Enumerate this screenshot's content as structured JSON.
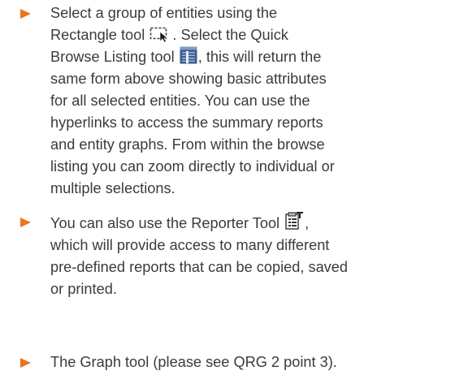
{
  "bullet_color": "#e8761e",
  "text_color": "#3b3b3b",
  "bullets": [
    {
      "icon_names": [
        "rectangle-select-tool-icon",
        "quick-browse-listing-tool-icon"
      ],
      "lines": {
        "l1": "Select a group of entities using the",
        "l2a": "Rectangle tool",
        "l2b": ". Select the Quick",
        "l3a": "Browse Listing tool",
        "l3b": ", this will return the",
        "l4": "same form above showing basic attributes",
        "l5": "for all selected entities. You can use the",
        "l6": "hyperlinks to access the summary reports",
        "l7": "and entity graphs. From within the browse",
        "l8": "listing you can zoom directly to individual or",
        "l9": "multiple selections."
      }
    },
    {
      "icon_names": [
        "reporter-tool-icon"
      ],
      "lines": {
        "l1a": "You can also use the Reporter Tool",
        "l1b": ",",
        "l2": "which will provide access to many different",
        "l3": "pre-defined reports that can be copied, saved",
        "l4": "or printed."
      }
    },
    {
      "icon_names": [],
      "lines": {
        "l1": "The Graph tool (please see QRG 2 point 3)."
      }
    }
  ]
}
